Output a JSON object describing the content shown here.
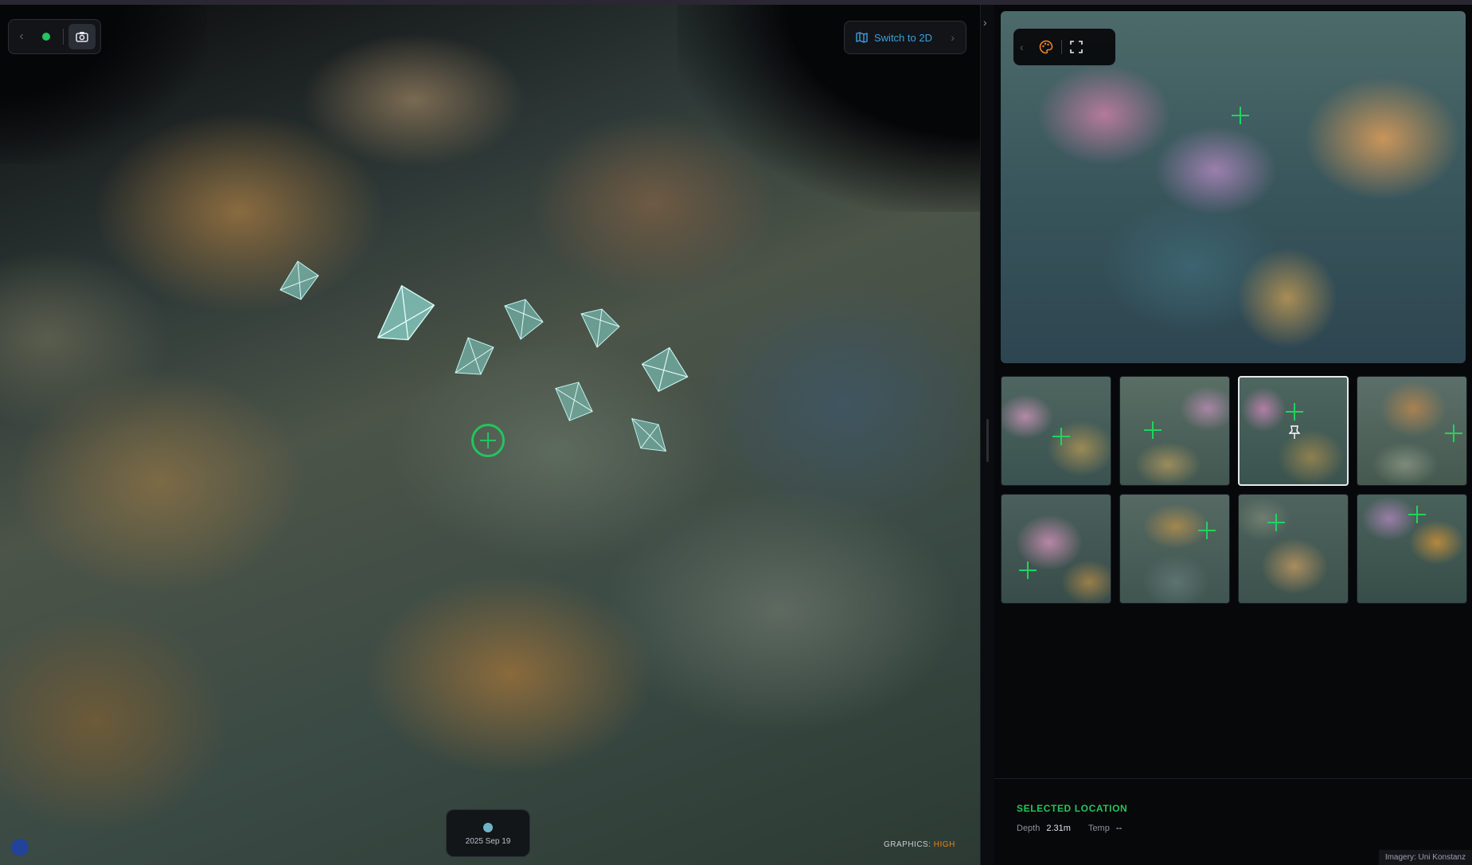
{
  "viewer": {
    "toolbar": {
      "prev_icon": "chevron-left-icon",
      "status": "online",
      "status_color": "#22c55e",
      "camera_icon": "camera-icon"
    },
    "switch_button": {
      "label": "Switch to 2D",
      "icon": "map-icon",
      "color": "#3aa0e0"
    },
    "timeline": {
      "date": "2025 Sep 19"
    },
    "graphics": {
      "label": "GRAPHICS:",
      "value": "HIGH"
    }
  },
  "panel": {
    "photo_toolbar": {
      "prev_icon": "chevron-left-icon",
      "palette_icon": "palette-icon",
      "fullscreen_icon": "fullscreen-icon",
      "accent": "#f08a24"
    },
    "thumbnails": [
      {
        "index": 1,
        "selected": false
      },
      {
        "index": 2,
        "selected": false
      },
      {
        "index": 3,
        "selected": true
      },
      {
        "index": 4,
        "selected": false
      },
      {
        "index": 5,
        "selected": false
      },
      {
        "index": 6,
        "selected": false
      },
      {
        "index": 7,
        "selected": false
      },
      {
        "index": 8,
        "selected": false
      }
    ],
    "selected_location": {
      "title": "SELECTED LOCATION",
      "depth_label": "Depth",
      "depth_value": "2.31m",
      "temp_label": "Temp",
      "temp_value": "--"
    },
    "imagery_credit": "Imagery: Uni Konstanz"
  }
}
